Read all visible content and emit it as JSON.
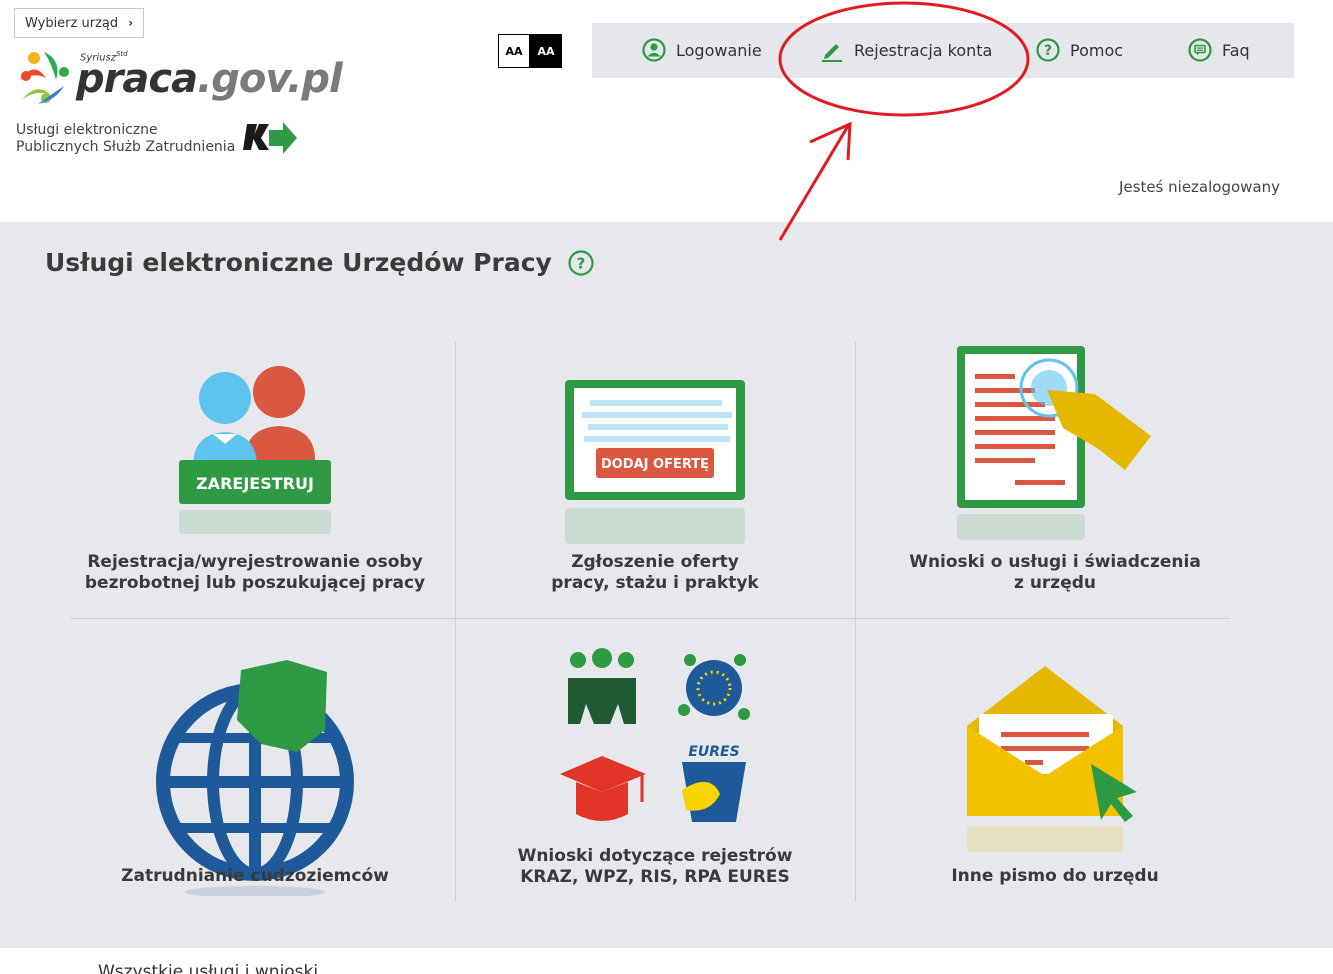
{
  "header": {
    "choose_office": "Wybierz urząd",
    "logo_brand_1": "praca",
    "logo_brand_2": ".gov.pl",
    "logo_sub": "Syriusz",
    "logo_sub_sup": "Std",
    "services_line1": "Usługi elektroniczne",
    "services_line2": "Publicznych Służb Zatrudnienia",
    "font_small": "AA",
    "font_large": "AA",
    "login_status": "Jesteś niezalogowany"
  },
  "nav": {
    "login": "Logowanie",
    "register": "Rejestracja konta",
    "help": "Pomoc",
    "faq": "Faq"
  },
  "main": {
    "title": "Usługi elektroniczne Urzędów Pracy",
    "tiles": [
      {
        "label1": "Rejestracja/wyrejestrowanie osoby",
        "label2": "bezrobotnej lub poszukującej pracy",
        "badge": "ZAREJESTRUJ"
      },
      {
        "label1": "Zgłoszenie oferty",
        "label2": "pracy, stażu i praktyk",
        "badge": "DODAJ OFERTĘ"
      },
      {
        "label1": "Wnioski o usługi i świadczenia",
        "label2": "z urzędu"
      },
      {
        "label1": "Zatrudnianie cudzoziemców"
      },
      {
        "label1": "Wnioski dotyczące rejestrów",
        "label2": "KRAZ, WPZ, RIS, RPA EURES",
        "badge": "EURES"
      },
      {
        "label1": "Inne pismo do urzędu"
      }
    ]
  },
  "footer": {
    "text": "Wszystkie usługi i wnioski"
  },
  "colors": {
    "green": "#2e9a43",
    "red_annotation": "#e11b22",
    "nav_bg": "#e6e7ea",
    "main_bg": "#e7e8eb"
  }
}
